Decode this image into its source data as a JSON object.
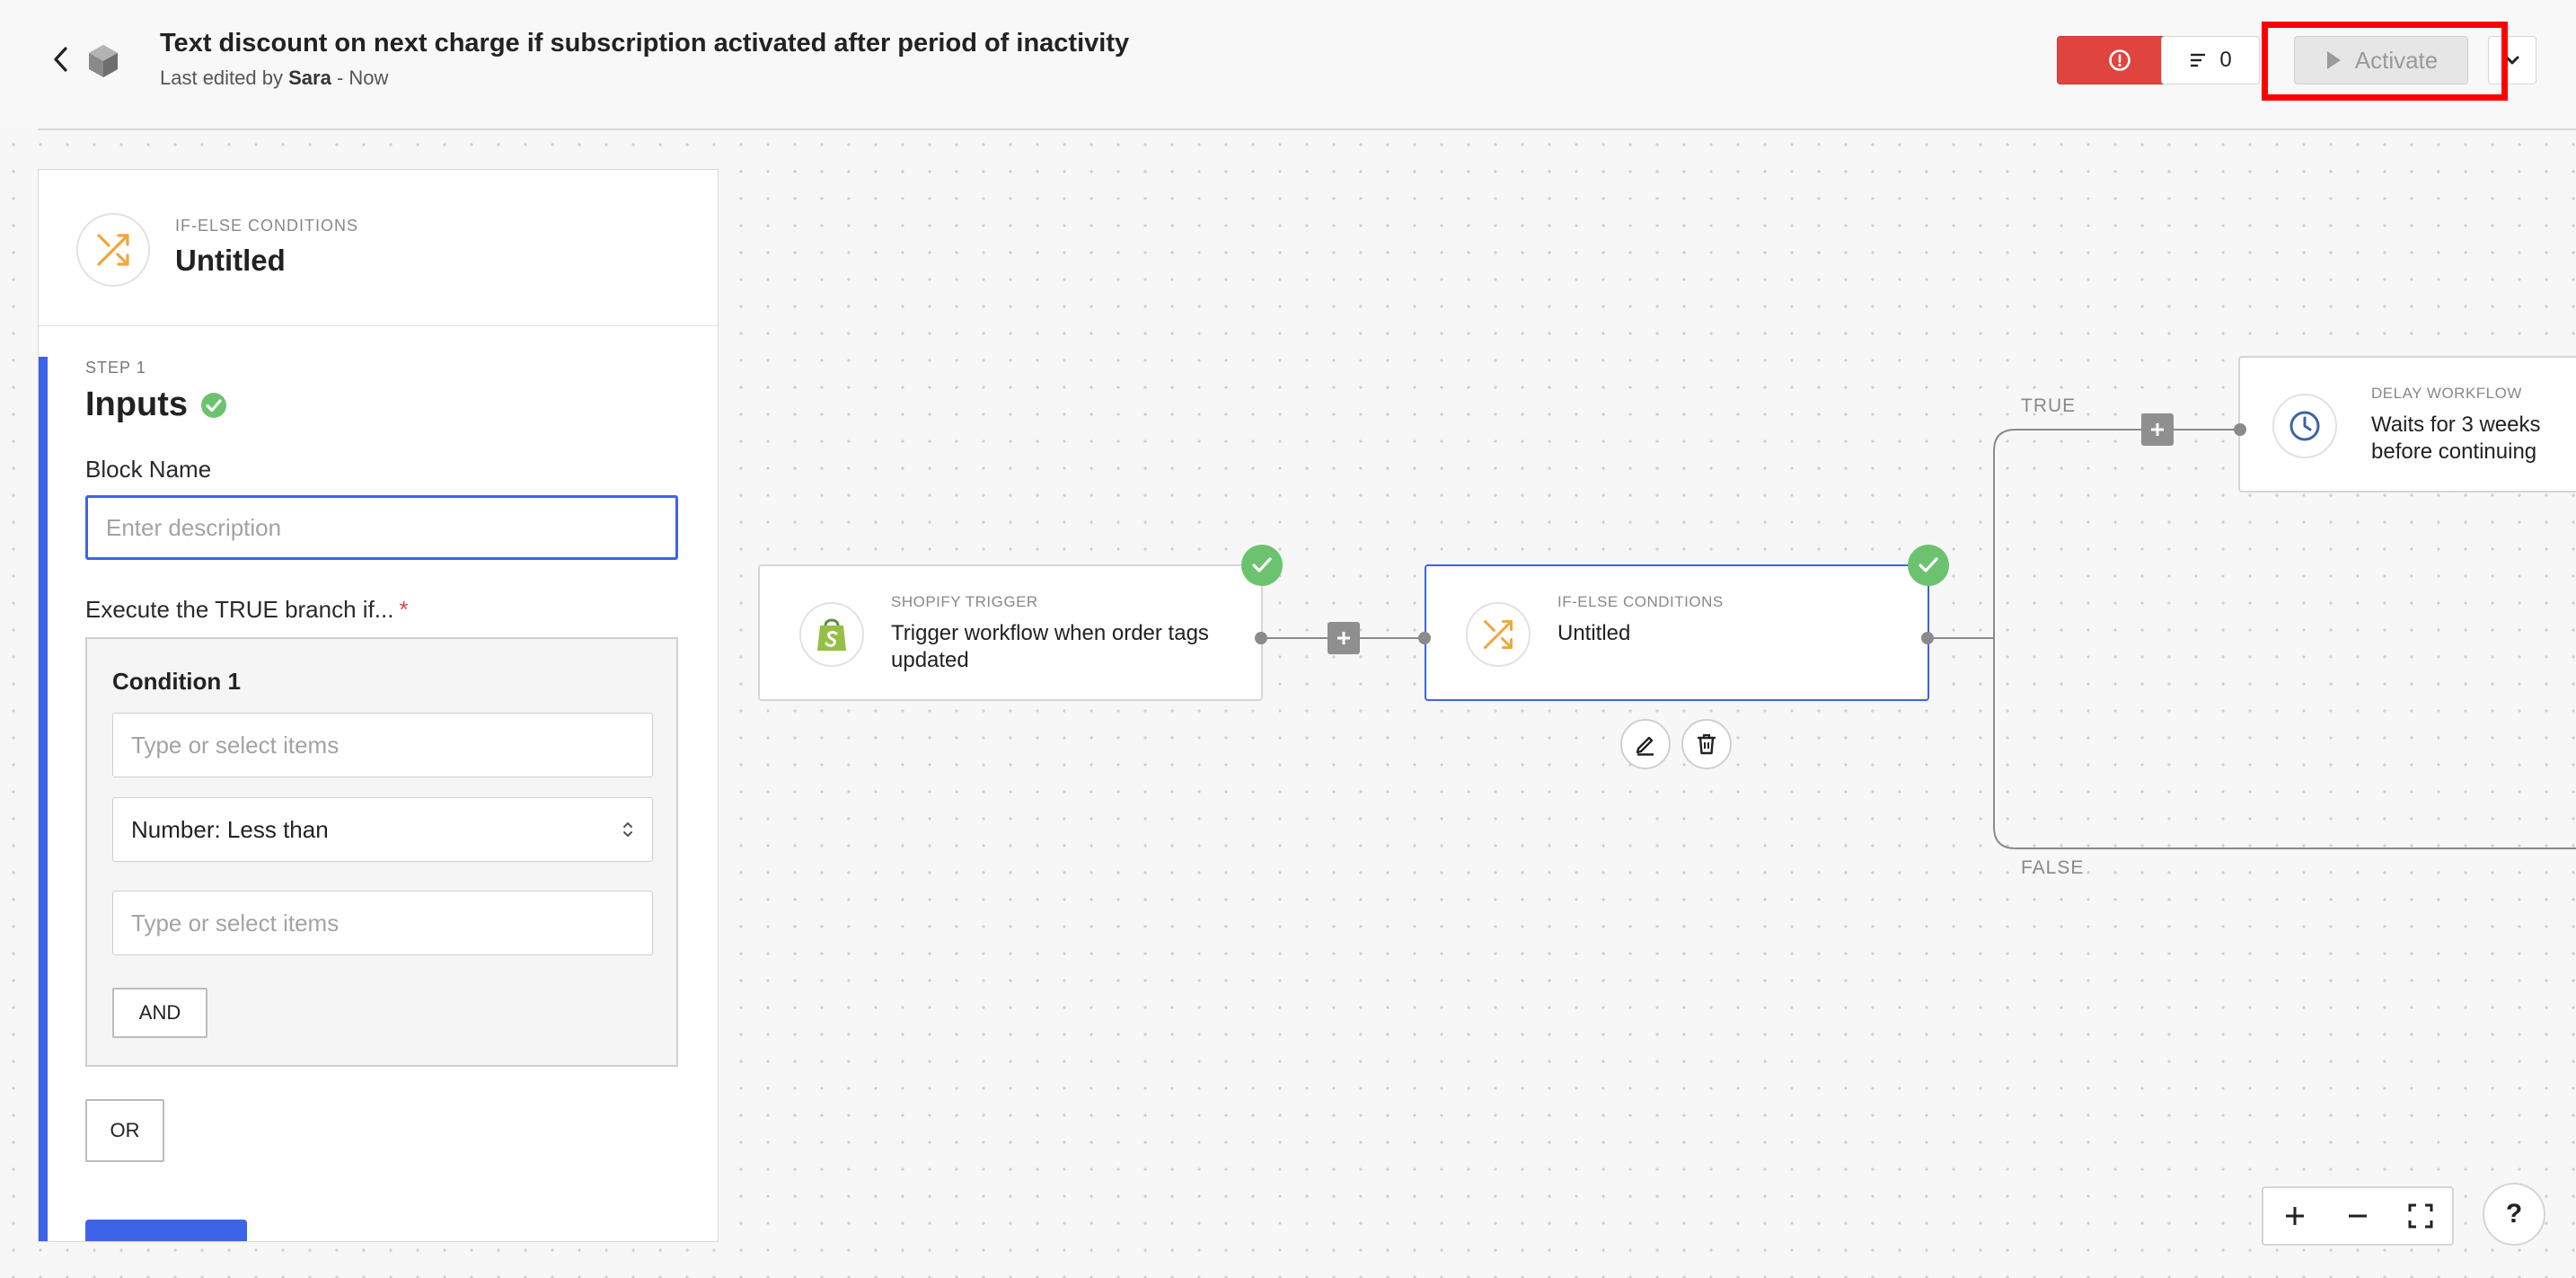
{
  "header": {
    "title": "Text discount on next charge if subscription activated after period of inactivity",
    "subtitle_prefix": "Last edited by ",
    "subtitle_user": "Sara",
    "subtitle_suffix": " - Now",
    "notes_count": "0",
    "activate_label": "Activate"
  },
  "panel": {
    "kicker": "IF-ELSE CONDITIONS",
    "name": "Untitled",
    "step_label": "STEP 1",
    "step_title": "Inputs",
    "block_name_label": "Block Name",
    "block_name_placeholder": "Enter description",
    "execute_label": "Execute the TRUE branch if...",
    "required_mark": "*",
    "condition": {
      "title": "Condition 1",
      "left_placeholder": "Type or select items",
      "operator": "Number: Less than",
      "right_placeholder": "Type or select items",
      "and_label": "AND"
    },
    "or_label": "OR"
  },
  "canvas": {
    "trigger_node": {
      "kicker": "SHOPIFY TRIGGER",
      "text": "Trigger workflow when order tags updated"
    },
    "ifelse_node": {
      "kicker": "IF-ELSE CONDITIONS",
      "text": "Untitled"
    },
    "delay_node": {
      "kicker": "DELAY WORKFLOW",
      "text": "Waits for 3 weeks before continuing"
    },
    "true_label": "TRUE",
    "false_label": "FALSE"
  },
  "help_label": "?",
  "colors": {
    "accent": "#3d63e8",
    "error": "#e0443e",
    "success": "#6cc36f",
    "highlight": "#ff0000"
  },
  "icons": [
    "chevron-left-icon",
    "logo-icon",
    "alert-circle-icon",
    "notes-icon",
    "play-icon",
    "chevron-down-icon",
    "shuffle-icon",
    "check-circle-icon",
    "shopify-icon",
    "clock-icon",
    "plus-icon",
    "edit-icon",
    "trash-icon",
    "zoom-in-icon",
    "zoom-out-icon",
    "fullscreen-icon"
  ]
}
